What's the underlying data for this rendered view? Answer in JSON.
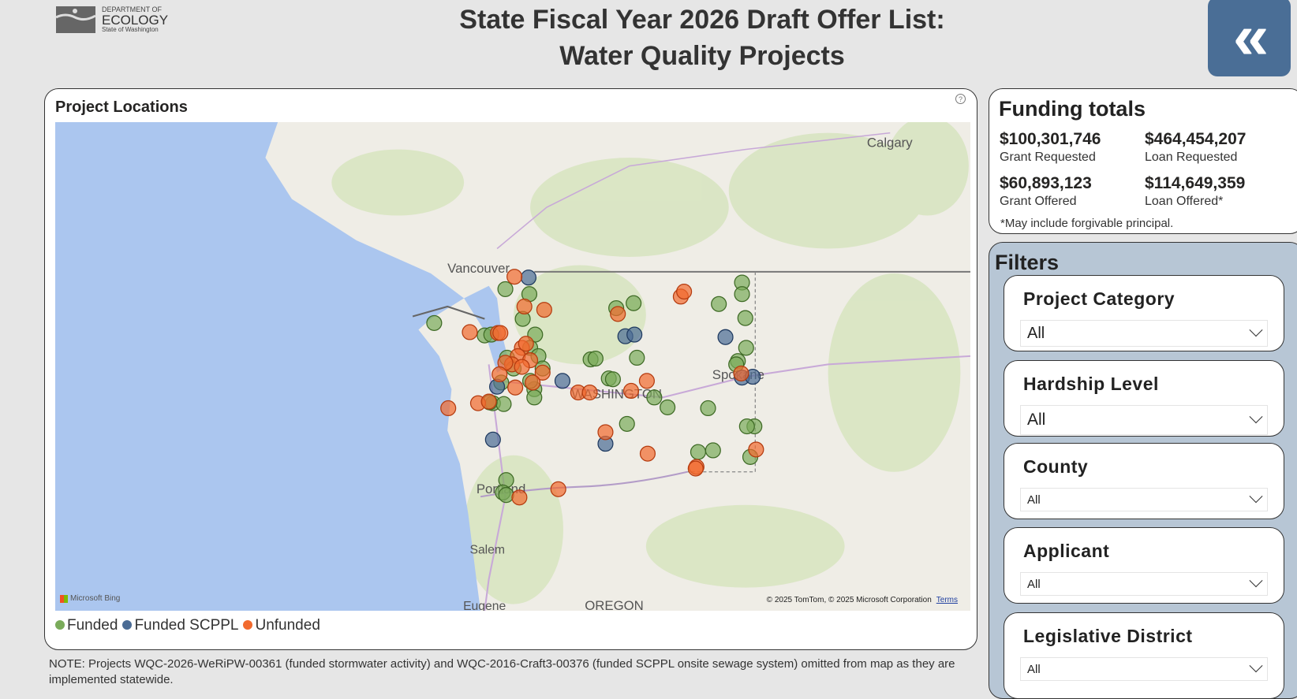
{
  "header": {
    "logo": {
      "line1": "DEPARTMENT OF",
      "line2": "ECOLOGY",
      "line3": "State of Washington"
    },
    "title_line1": "State Fiscal Year 2026 Draft Offer List:",
    "title_line2": "Water Quality Projects",
    "back_icon": "double-chevron-left-icon",
    "back_glyph": "«"
  },
  "map": {
    "title": "Project Locations",
    "help": "?",
    "labels": {
      "vancouver": "Vancouver",
      "calgary": "Calgary",
      "portland": "Portland",
      "salem": "Salem",
      "eugene": "Eugene",
      "oregon": "OREGON",
      "washington": "WASHINGTON",
      "spokane": "Spokane"
    },
    "attribution": "Microsoft Bing",
    "copyright": "© 2025 TomTom, © 2025 Microsoft Corporation",
    "terms": "Terms",
    "legend": [
      {
        "label": "Funded",
        "color": "#7aab5a"
      },
      {
        "label": "Funded SCPPL",
        "color": "#4a6b94"
      },
      {
        "label": "Unfunded",
        "color": "#f26a2e"
      }
    ]
  },
  "note": "NOTE: Projects WQC-2026-WeRiPW-00361 (funded stormwater activity) and WQC-2016-Craft3-00376 (funded SCPPL onsite sewage system) omitted from map as they are implemented statewide.",
  "funding": {
    "title": "Funding totals",
    "items": [
      {
        "value": "$100,301,746",
        "label": "Grant Requested"
      },
      {
        "value": "$464,454,207",
        "label": "Loan Requested"
      },
      {
        "value": "$60,893,123",
        "label": "Grant Offered"
      },
      {
        "value": "$114,649,359",
        "label": "Loan Offered*"
      }
    ],
    "footnote": "*May include forgivable principal."
  },
  "filters": {
    "title": "Filters",
    "items": [
      {
        "label": "Project Category",
        "value": "All"
      },
      {
        "label": "Hardship Level",
        "value": "All"
      },
      {
        "label": "County",
        "value": "All"
      },
      {
        "label": "Applicant",
        "value": "All"
      },
      {
        "label": "Legislative District",
        "value": "All"
      }
    ]
  }
}
